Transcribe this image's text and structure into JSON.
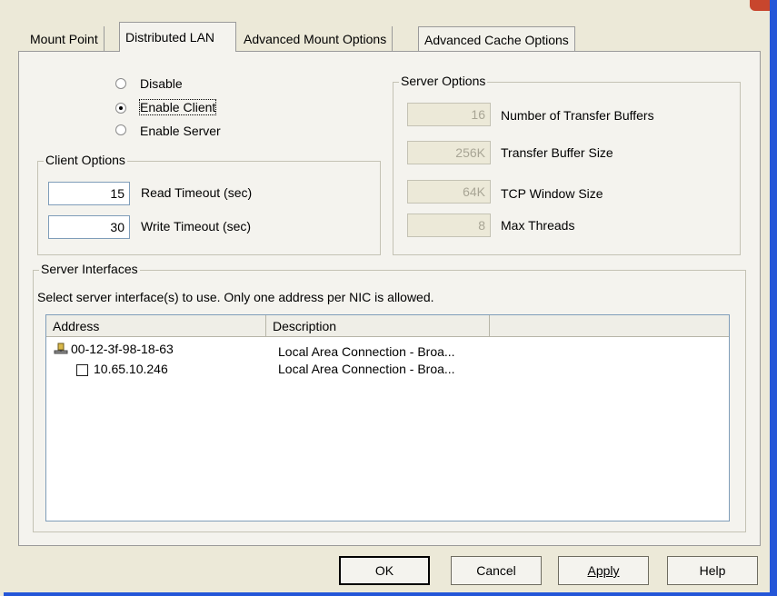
{
  "tabs": [
    {
      "label": "Mount Point",
      "selected": false
    },
    {
      "label": "Distributed LAN",
      "selected": true
    },
    {
      "label": "Advanced Mount Options",
      "selected": false
    },
    {
      "label": "Advanced Cache Options",
      "selected": false
    }
  ],
  "mode": {
    "disable_label": "Disable",
    "enable_client_label": "Enable Client",
    "enable_server_label": "Enable Server",
    "selected": "Enable Client"
  },
  "client_options": {
    "legend": "Client Options",
    "read_timeout": {
      "value": "15",
      "label": "Read Timeout (sec)"
    },
    "write_timeout": {
      "value": "30",
      "label": "Write Timeout (sec)"
    }
  },
  "server_options": {
    "legend": "Server Options",
    "transfer_buffers": {
      "value": "16",
      "label": "Number of Transfer Buffers"
    },
    "buffer_size": {
      "value": "256K",
      "label": "Transfer Buffer Size"
    },
    "tcp_window": {
      "value": "64K",
      "label": "TCP Window Size"
    },
    "max_threads": {
      "value": "8",
      "label": "Max Threads"
    }
  },
  "server_interfaces": {
    "legend": "Server Interfaces",
    "instruction": "Select server interface(s) to use.  Only one address per NIC is allowed.",
    "columns": [
      "Address",
      "Description",
      ""
    ],
    "rows": [
      {
        "address": "00-12-3f-98-18-63",
        "description": "Local Area Connection - Broa...",
        "icon": "network-adapter-icon"
      },
      {
        "address": "10.65.10.246",
        "description": "Local Area Connection - Broa...",
        "checked": false
      }
    ]
  },
  "buttons": {
    "ok": "OK",
    "cancel": "Cancel",
    "apply": "Apply",
    "help": "Help"
  },
  "colors": {
    "dialog_bg": "#ece9d8",
    "panel_bg": "#f4f3ee",
    "frame_blue": "#2456d8",
    "field_border": "#7f9db9",
    "disabled_text": "#a8a595"
  }
}
